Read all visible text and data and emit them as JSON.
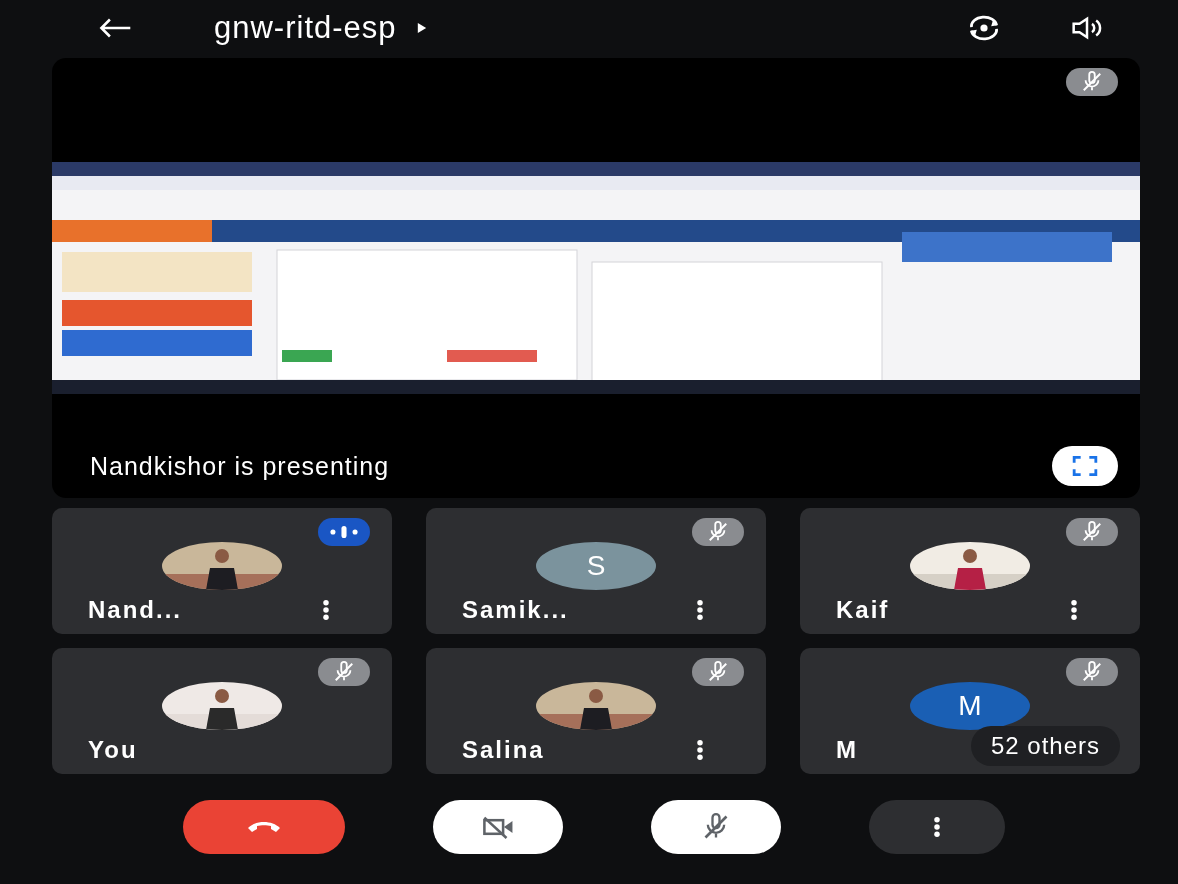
{
  "header": {
    "title": "gnw-ritd-esp"
  },
  "presentation": {
    "caption": "Nandkishor is presenting",
    "muted": true
  },
  "participants": [
    {
      "name": "Nand...",
      "kind": "picture",
      "speaking": true,
      "menu": true
    },
    {
      "name": "Samik...",
      "kind": "letter",
      "letter": "S",
      "color": "#7b939d",
      "speaking": false,
      "menu": true
    },
    {
      "name": "Kaif",
      "kind": "picture",
      "speaking": false,
      "menu": true
    },
    {
      "name": "You",
      "kind": "picture",
      "speaking": false,
      "menu": false
    },
    {
      "name": "Salina",
      "kind": "picture",
      "speaking": false,
      "menu": true
    },
    {
      "name": "M",
      "kind": "letter",
      "letter": "M",
      "color": "#1a5fb4",
      "speaking": false,
      "menu": false
    }
  ],
  "others": "52 others",
  "controls": [
    {
      "kind": "end-call"
    },
    {
      "kind": "camera",
      "on": false
    },
    {
      "kind": "mic",
      "on": false
    },
    {
      "kind": "more"
    }
  ]
}
